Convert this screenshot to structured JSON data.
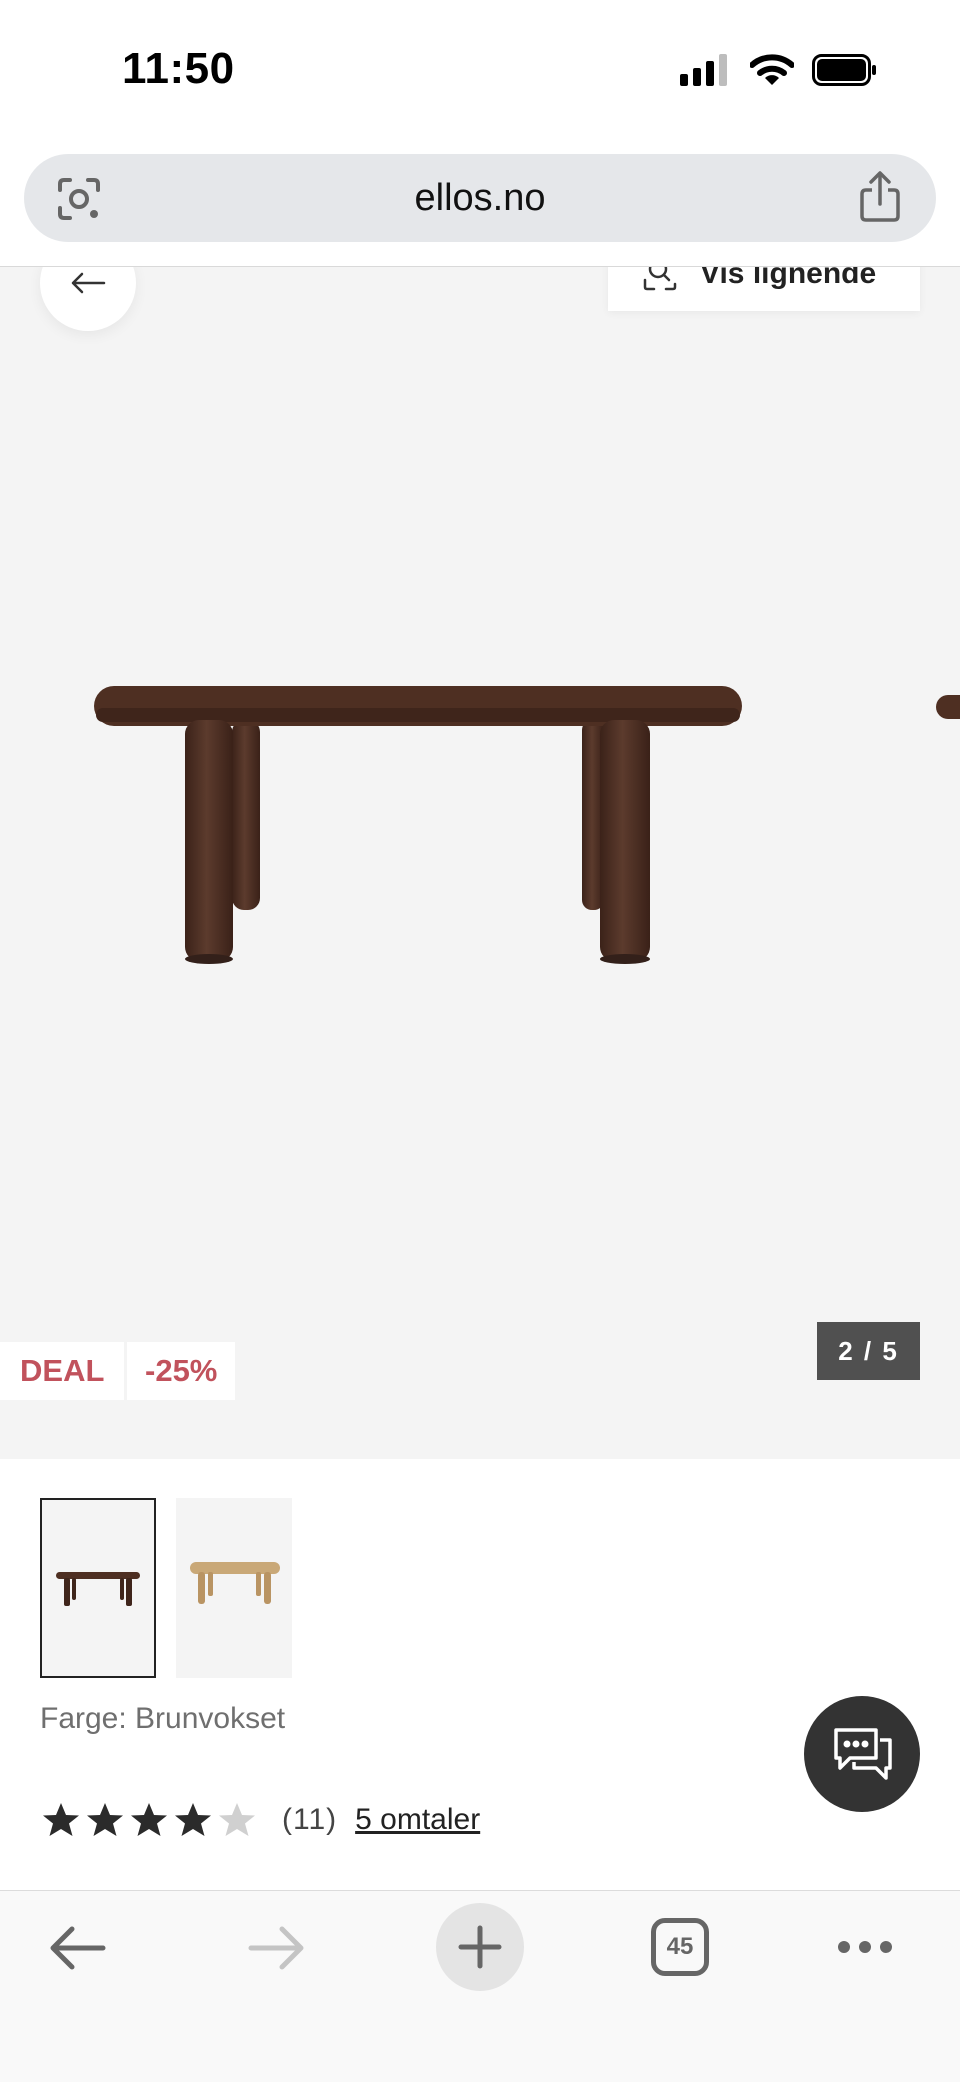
{
  "status_bar": {
    "time": "11:50",
    "icons": [
      "signal-icon",
      "wifi-icon",
      "battery-icon"
    ]
  },
  "browser": {
    "url": "ellos.no",
    "lens_icon": "camera-lens-icon",
    "share_icon": "share-icon"
  },
  "gallery": {
    "back_icon": "arrow-left-icon",
    "similar_label": "Vis lignende",
    "similar_icon": "visual-search-icon",
    "badge_deal": "DEAL",
    "badge_discount": "-25%",
    "counter": "2 / 5"
  },
  "product": {
    "thumbnails": [
      "Brunvokset",
      "light-wood"
    ],
    "color_line": "Farge: Brunvokset",
    "rating_value": 4,
    "rating_max": 5,
    "rating_count": "(11)",
    "reviews_link": "5 omtaler"
  },
  "toolbar": {
    "back_icon": "arrow-left-icon",
    "forward_icon": "arrow-right-icon",
    "new_tab_icon": "plus-icon",
    "tab_count": "45",
    "more_icon": "more-dots-icon"
  },
  "colors": {
    "deal_red": "#c1525c",
    "image_bg": "#f4f4f4",
    "dark_wood": "#4e2f22",
    "chat_bg": "#333333"
  }
}
